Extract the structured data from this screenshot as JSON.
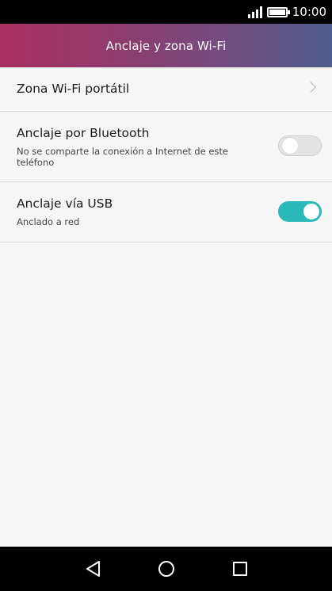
{
  "status_bar": {
    "time": "10:00",
    "icons": [
      "signal-icon",
      "battery-icon"
    ]
  },
  "app_bar": {
    "title": "Anclaje y zona Wi-Fi",
    "gradient": [
      "#a8305e",
      "#4f5d8f"
    ]
  },
  "settings": {
    "items": [
      {
        "title": "Zona Wi-Fi portátil",
        "icon": "chevron-right-icon"
      },
      {
        "title": "Anclaje por Bluetooth",
        "subtitle": "No se comparte la conexión a Internet de este teléfono",
        "toggle": "off"
      },
      {
        "title": "Anclaje vía USB",
        "subtitle": "Anclado a red",
        "toggle": "on",
        "accent": "#2ab8b8"
      }
    ]
  },
  "nav_bar": {
    "icons": [
      "back-icon",
      "home-icon",
      "recent-apps-icon"
    ]
  }
}
